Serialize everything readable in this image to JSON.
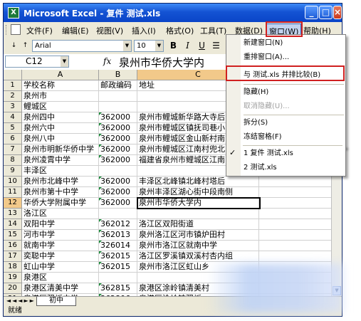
{
  "window": {
    "title": "Microsoft Excel - 复件 测试.xls",
    "logo_label": "X",
    "min": "_",
    "max": "□",
    "close": "×"
  },
  "menu": [
    "文件(F)",
    "编辑(E)",
    "视图(V)",
    "插入(I)",
    "格式(O)",
    "工具(T)",
    "数据(D)",
    "窗口(W)",
    "帮助(H)"
  ],
  "toolbar": {
    "font": "Arial",
    "size": "10",
    "bold": "B",
    "italic": "I",
    "underline": "U"
  },
  "formula": {
    "cell_ref": "C12",
    "fx": "fx",
    "value": "泉州市华侨大学内"
  },
  "columns": [
    "A",
    "B",
    "C"
  ],
  "rows": [
    {
      "n": "1",
      "a": "学校名称",
      "b": "邮政编码",
      "c": "地址",
      "tag": false
    },
    {
      "n": "2",
      "a": "泉州市",
      "b": "",
      "c": "",
      "tag": false
    },
    {
      "n": "3",
      "a": "鲤城区",
      "b": "",
      "c": "",
      "tag": false
    },
    {
      "n": "4",
      "a": "泉州四中",
      "b": "362000",
      "c": "泉州市鲤城新华路大寺后",
      "tag": true
    },
    {
      "n": "5",
      "a": "泉州六中",
      "b": "362000",
      "c": "泉州市鲤城区镇抚司巷小",
      "tag": true
    },
    {
      "n": "6",
      "a": "泉州八中",
      "b": "362000",
      "c": "泉州市鲤城区金山新村南区",
      "tag": true
    },
    {
      "n": "7",
      "a": "泉州市明新华侨中学",
      "b": "362000",
      "c": "泉州市鲤城区江南村兜北",
      "tag": true
    },
    {
      "n": "8",
      "a": "泉州凌霄中学",
      "b": "362000",
      "c": "福建省泉州市鲤城区江南",
      "tag": true
    },
    {
      "n": "9",
      "a": "丰泽区",
      "b": "",
      "c": "",
      "tag": false
    },
    {
      "n": "10",
      "a": "泉州市北峰中学",
      "b": "362000",
      "c": "丰泽区北峰镇北峰村塔后",
      "tag": true
    },
    {
      "n": "11",
      "a": "泉州市第十中学",
      "b": "362000",
      "c": "泉州丰泽区湖心街中段南侧",
      "tag": true
    },
    {
      "n": "12",
      "a": "华侨大学附属中学",
      "b": "362000",
      "c": "泉州市华侨大学内",
      "tag": true
    },
    {
      "n": "13",
      "a": "洛江区",
      "b": "",
      "c": "",
      "tag": false
    },
    {
      "n": "14",
      "a": "双阳中学",
      "b": "362012",
      "c": "洛江区双阳街道",
      "tag": true
    },
    {
      "n": "15",
      "a": "河市中学",
      "b": "362013",
      "c": "泉州洛江区河市镇炉田村",
      "tag": true
    },
    {
      "n": "16",
      "a": "就南中学",
      "b": "326014",
      "c": "泉州市洛江区就南中学",
      "tag": true
    },
    {
      "n": "17",
      "a": "奕聪中学",
      "b": "362015",
      "c": "洛江区罗溪镇双溪村杏内组",
      "tag": true
    },
    {
      "n": "18",
      "a": "虹山中学",
      "b": "362015",
      "c": "泉州市洛江区虹山乡",
      "tag": true
    },
    {
      "n": "19",
      "a": "泉港区",
      "b": "",
      "c": "",
      "tag": false
    },
    {
      "n": "20",
      "a": "泉港区清美中学",
      "b": "362815",
      "c": "泉港区涂岭镇清美村",
      "tag": true
    },
    {
      "n": "21",
      "a": "泉港区驿坂中学",
      "b": "362806",
      "c": "泉港区涂岭镇驿坂",
      "tag": true
    }
  ],
  "sheet": {
    "nav": "◄◄◄►►",
    "tab": "初中"
  },
  "status": "就绪",
  "window_menu": {
    "items": [
      {
        "label": "新建窗口(N)",
        "disabled": false
      },
      {
        "label": "重排窗口(A)...",
        "disabled": false
      },
      {
        "label": "与 测试.xls 并排比较(B)",
        "disabled": false
      },
      {
        "label": "隐藏(H)",
        "disabled": false
      },
      {
        "label": "取消隐藏(U)...",
        "disabled": true
      },
      {
        "label": "拆分(S)",
        "disabled": false
      },
      {
        "label": "冻结窗格(F)",
        "disabled": false
      },
      {
        "label": "1 复件 测试.xls",
        "disabled": false
      },
      {
        "label": "2 测试.xls",
        "disabled": false
      }
    ],
    "check": "✓"
  }
}
